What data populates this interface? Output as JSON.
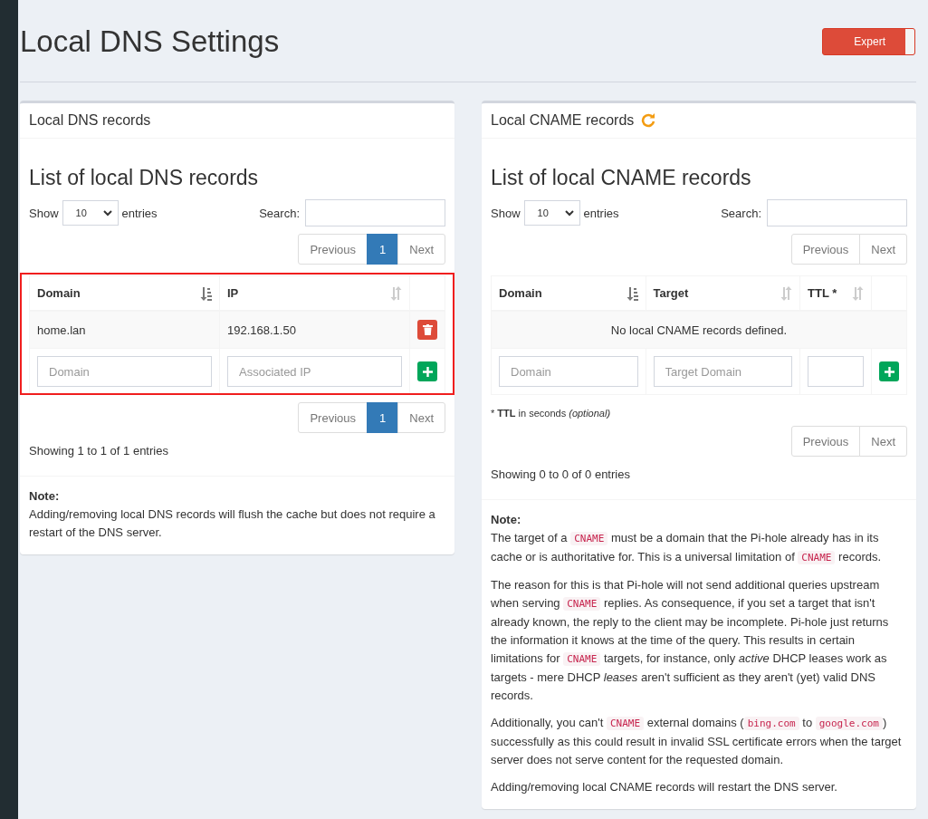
{
  "page": {
    "title": "Local DNS Settings",
    "expert_toggle": {
      "label": "Expert",
      "on": true
    }
  },
  "cards": [
    {
      "header": "Local DNS records",
      "list_title": "List of local DNS records",
      "length": {
        "before": "Show",
        "value": "10",
        "after": "entries"
      },
      "search_label": "Search:",
      "pagination_top": [
        {
          "label": "Previous",
          "selected": false
        },
        {
          "label": "1",
          "selected": true
        },
        {
          "label": "Next",
          "selected": false
        }
      ],
      "table": {
        "highlighted": true,
        "columns": [
          {
            "label": "Domain",
            "sorted": true,
            "placeholder": "Domain"
          },
          {
            "label": "IP",
            "sorted": false,
            "placeholder": "Associated IP"
          }
        ],
        "rows": [
          {
            "cells": [
              "home.lan",
              "192.168.1.50"
            ]
          }
        ]
      },
      "pagination_bottom": [
        {
          "label": "Previous",
          "selected": false
        },
        {
          "label": "1",
          "selected": true
        },
        {
          "label": "Next",
          "selected": false
        }
      ],
      "info": "Showing 1 to 1 of 1 entries",
      "note": {
        "title": "Note:",
        "paragraphs": [
          [
            {
              "kind": "text",
              "text": "Adding/removing local DNS records will flush the cache but does not require a restart of the DNS server."
            }
          ]
        ]
      }
    },
    {
      "header": "Local CNAME records",
      "list_title": "List of local CNAME records",
      "length": {
        "before": "Show",
        "value": "10",
        "after": "entries"
      },
      "search_label": "Search:",
      "pagination_top": [
        {
          "label": "Previous",
          "selected": false
        },
        {
          "label": "Next",
          "selected": false
        }
      ],
      "table": {
        "highlighted": false,
        "columns": [
          {
            "label": "Domain",
            "sorted": true,
            "placeholder": "Domain"
          },
          {
            "label": "Target",
            "sorted": false,
            "placeholder": "Target Domain"
          },
          {
            "label": "TTL *",
            "sorted": false
          }
        ],
        "empty_message": "No local CNAME records defined."
      },
      "footnote": "* **TTL** in seconds *(optional)*",
      "pagination_bottom": [
        {
          "label": "Previous",
          "selected": false
        },
        {
          "label": "Next",
          "selected": false
        }
      ],
      "info": "Showing 0 to 0 of 0 entries",
      "note": {
        "title": "Note:",
        "paragraphs": [
          [
            {
              "kind": "text",
              "text": "The target of a "
            },
            {
              "kind": "code",
              "text": "CNAME"
            },
            {
              "kind": "text",
              "text": " must be a domain that the Pi-hole already has in its cache or is authoritative for. This is a universal limitation of "
            },
            {
              "kind": "code",
              "text": "CNAME"
            },
            {
              "kind": "text",
              "text": " records."
            }
          ],
          [
            {
              "kind": "text",
              "text": "The reason for this is that Pi-hole will not send additional queries upstream when serving "
            },
            {
              "kind": "code",
              "text": "CNAME"
            },
            {
              "kind": "text",
              "text": " replies. As consequence, if you set a target that isn't already known, the reply to the client may be incomplete. Pi-hole just returns the information it knows at the time of the query. This results in certain limitations for "
            },
            {
              "kind": "code",
              "text": "CNAME"
            },
            {
              "kind": "text",
              "text": " targets, for instance, only *active* DHCP leases work as targets - mere DHCP *leases* aren't sufficient as they aren't (yet) valid DNS records."
            }
          ],
          [
            {
              "kind": "text",
              "text": "Additionally, you can't "
            },
            {
              "kind": "code",
              "text": "CNAME"
            },
            {
              "kind": "text",
              "text": " external domains ("
            },
            {
              "kind": "code",
              "text": "bing.com"
            },
            {
              "kind": "text",
              "text": " to "
            },
            {
              "kind": "code",
              "text": "google.com"
            },
            {
              "kind": "text",
              "text": ") successfully as this could result in invalid SSL certificate errors when the target server does not serve content for the requested domain."
            }
          ],
          [
            {
              "kind": "text",
              "text": "Adding/removing local CNAME records will restart the DNS server."
            }
          ]
        ]
      }
    }
  ]
}
